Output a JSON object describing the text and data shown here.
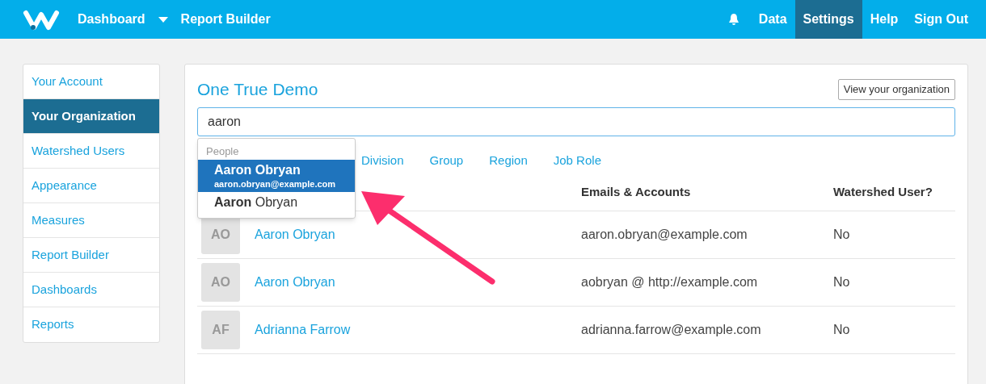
{
  "nav": {
    "left": [
      {
        "label": "Dashboard",
        "kind": "dropdown"
      },
      {
        "label": "Report Builder",
        "kind": "link"
      }
    ],
    "right": [
      {
        "label": "Data",
        "selected": false
      },
      {
        "label": "Settings",
        "selected": true
      },
      {
        "label": "Help",
        "selected": false
      },
      {
        "label": "Sign Out",
        "selected": false
      }
    ]
  },
  "sidebar": {
    "items": [
      {
        "label": "Your Account",
        "selected": false
      },
      {
        "label": "Your Organization",
        "selected": true
      },
      {
        "label": "Watershed Users",
        "selected": false
      },
      {
        "label": "Appearance",
        "selected": false
      },
      {
        "label": "Measures",
        "selected": false
      },
      {
        "label": "Report Builder",
        "selected": false
      },
      {
        "label": "Dashboards",
        "selected": false
      },
      {
        "label": "Reports",
        "selected": false
      }
    ]
  },
  "main": {
    "title": "One True Demo",
    "view_button": "View your organization",
    "search": {
      "value": "aaron"
    },
    "filters": [
      "Division",
      "Group",
      "Region",
      "Job Role"
    ],
    "columns": [
      "Emails & Accounts",
      "Watershed User?"
    ],
    "rows": [
      {
        "initials": "AO",
        "name": "Aaron Obryan",
        "email": "aaron.obryan@example.com",
        "watershed": "No"
      },
      {
        "initials": "AO",
        "name": "Aaron Obryan",
        "email": "aobryan @ http://example.com",
        "watershed": "No"
      },
      {
        "initials": "AF",
        "name": "Adrianna Farrow",
        "email": "adrianna.farrow@example.com",
        "watershed": "No"
      }
    ],
    "dropdown": {
      "heading": "People",
      "items": [
        {
          "name": "**Aaron** Obryan",
          "email": "aaron.obryan@example.com",
          "selected": true
        },
        {
          "name": "**Aaron** Obryan",
          "selected": false
        }
      ]
    }
  }
}
